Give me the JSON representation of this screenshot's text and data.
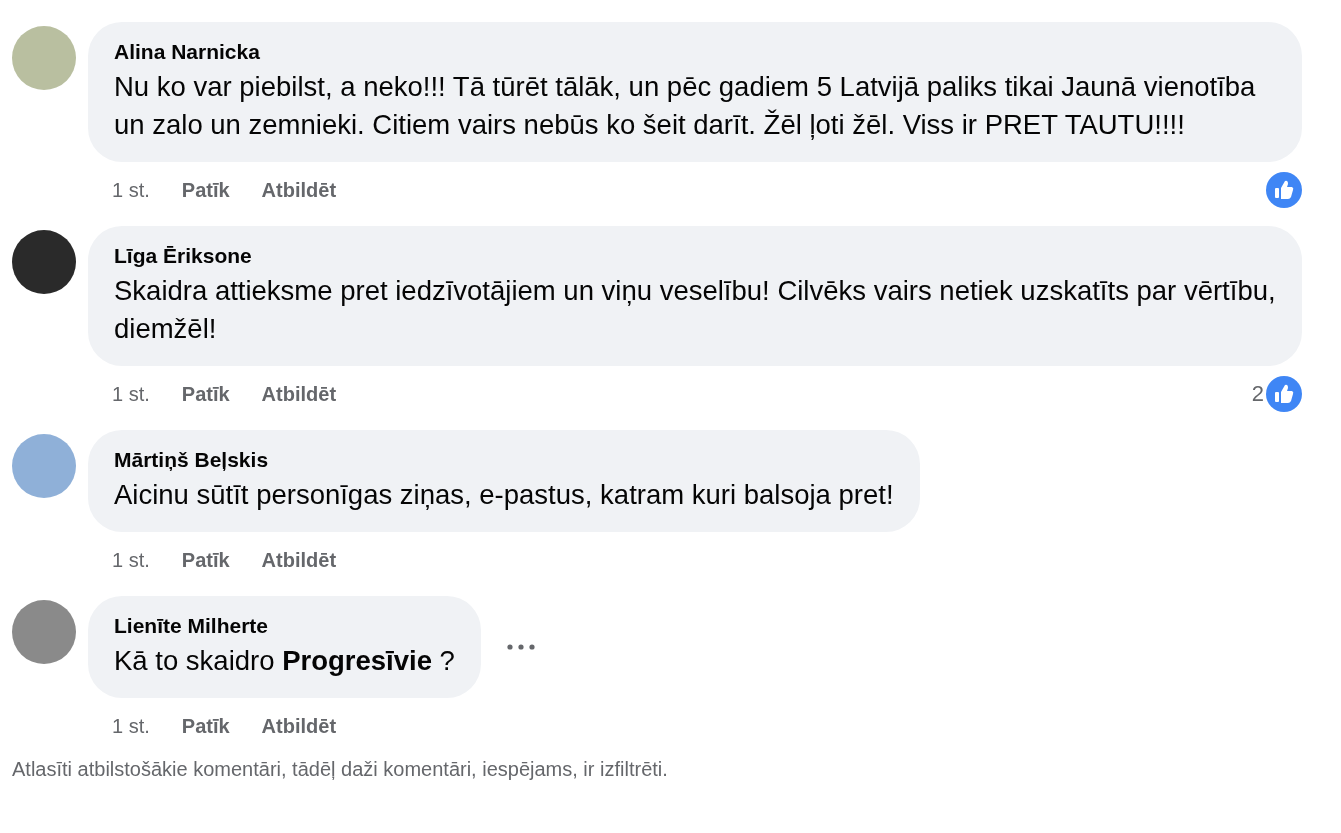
{
  "comments": [
    {
      "author": "Alina Narnicka",
      "text": "Nu ko var piebilst, a neko!!! Tā tūrēt tālāk, un pēc gadiem 5 Latvijā paliks tikai Jaunā vienotība un zalo un zemnieki. Citiem vairs nebūs ko šeit darīt. Žēl ļoti žēl. Viss ir PRET TAUTU!!!!",
      "time": "1 st.",
      "like": "Patīk",
      "reply": "Atbildēt",
      "liked": true,
      "show_more": false
    },
    {
      "author": "Līga Ēriksone",
      "text": "Skaidra attieksme pret iedzīvotājiem un viņu veselību! Cilvēks vairs netiek uzskatīts par vērtību, diemžēl!",
      "time": "1 st.",
      "like": "Patīk",
      "reply": "Atbildēt",
      "liked": true,
      "like_count": "2",
      "show_more": false
    },
    {
      "author": "Mārtiņš Beļskis",
      "text": "Aicinu sūtīt personīgas ziņas, e-pastus, katram kuri balsoja pret!",
      "time": "1 st.",
      "like": "Patīk",
      "reply": "Atbildēt",
      "liked": false,
      "show_more": false
    },
    {
      "author": "Lienīte Milherte",
      "text": "Kā to skaidro **Progresīvie** ?",
      "time": "1 st.",
      "like": "Patīk",
      "reply": "Atbildēt",
      "liked": false,
      "show_more": true
    }
  ],
  "footer": "Atlasīti atbilstošākie komentāri, tādēļ daži komentāri, iespējams, ir izfiltrēti."
}
